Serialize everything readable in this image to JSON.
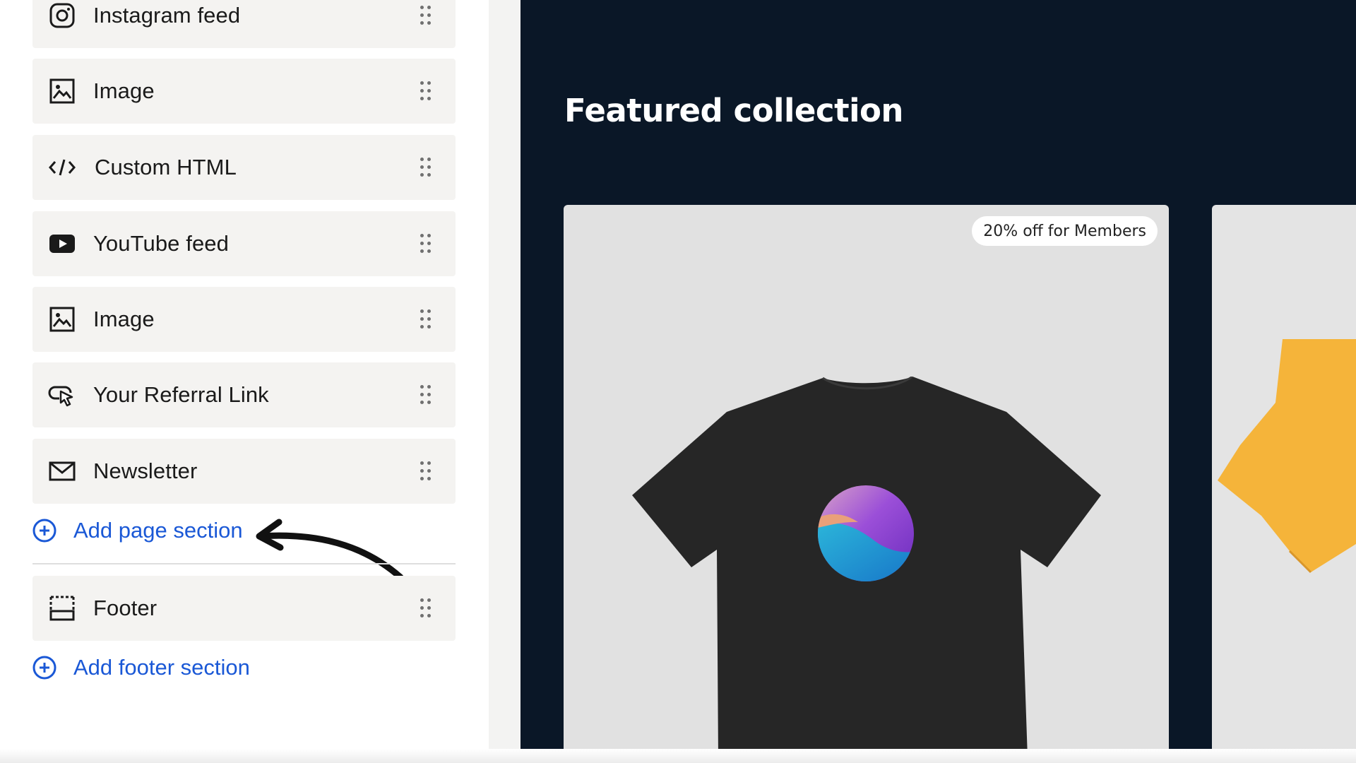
{
  "sidebar": {
    "items": [
      {
        "label": "Instagram feed",
        "icon": "instagram-icon"
      },
      {
        "label": "Image",
        "icon": "image-icon"
      },
      {
        "label": "Custom HTML",
        "icon": "code-icon"
      },
      {
        "label": "YouTube feed",
        "icon": "youtube-icon"
      },
      {
        "label": "Image",
        "icon": "image-icon"
      },
      {
        "label": "Your Referral Link",
        "icon": "referral-link-icon"
      },
      {
        "label": "Newsletter",
        "icon": "mail-icon"
      }
    ],
    "add_page_section": "Add page section",
    "footer": {
      "label": "Footer",
      "icon": "footer-icon"
    },
    "add_footer_section": "Add footer section"
  },
  "preview": {
    "title": "Featured collection",
    "product_badge": "20% off for Members"
  },
  "colors": {
    "link": "#1a58d6",
    "preview_background": "#0a1727",
    "item_background": "#f4f3f1",
    "second_product": "#f5b43a"
  }
}
